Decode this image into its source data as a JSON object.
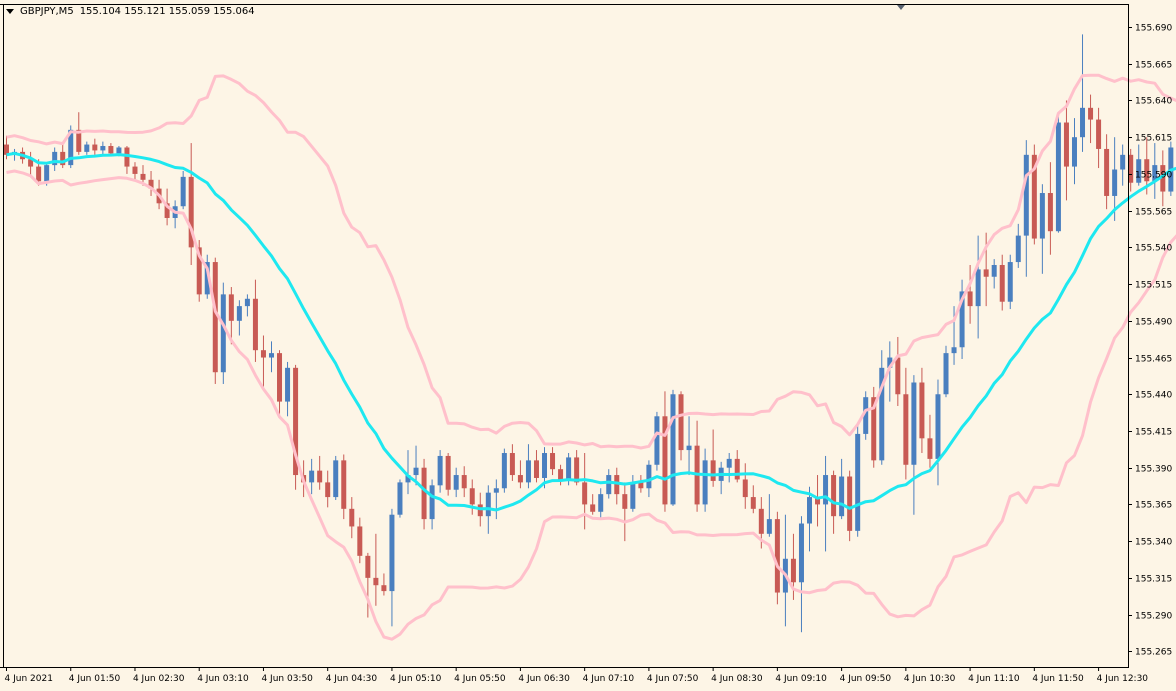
{
  "header": {
    "symbol": "GBPJPY,M5",
    "ohlc": "155.104 155.121 155.059 155.064"
  },
  "colors": {
    "background": "#fdf5e6",
    "bull_candle": "#4a7fbf",
    "bear_candle": "#c85a54",
    "middle_band": "#1ee8f0",
    "outer_bands": "#ffc0cb",
    "axis": "#000000"
  },
  "chart_data": {
    "type": "candlestick",
    "indicator": "bollinger bands",
    "grid": false,
    "ylim": [
      155.255,
      155.705
    ],
    "y_ticks": [
      "155.690",
      "155.665",
      "155.640",
      "155.615",
      "155.590",
      "155.565",
      "155.540",
      "155.515",
      "155.490",
      "155.465",
      "155.440",
      "155.415",
      "155.390",
      "155.365",
      "155.340",
      "155.315",
      "155.290",
      "155.265"
    ],
    "x_ticks": [
      "4 Jun 2021",
      "4 Jun 01:50",
      "4 Jun 02:30",
      "4 Jun 03:10",
      "4 Jun 03:50",
      "4 Jun 04:30",
      "4 Jun 05:10",
      "4 Jun 05:50",
      "4 Jun 06:30",
      "4 Jun 07:10",
      "4 Jun 07:50",
      "4 Jun 08:30",
      "4 Jun 09:10",
      "4 Jun 09:50",
      "4 Jun 10:30",
      "4 Jun 11:10",
      "4 Jun 11:50",
      "4 Jun 12:30"
    ],
    "candles": [
      [
        155.61,
        155.616,
        155.6,
        155.603
      ],
      [
        155.603,
        155.607,
        155.599,
        155.605
      ],
      [
        155.605,
        155.608,
        155.597,
        155.6
      ],
      [
        155.6,
        155.605,
        155.588,
        155.595
      ],
      [
        155.595,
        155.6,
        155.582,
        155.585
      ],
      [
        155.585,
        155.598,
        155.582,
        155.596
      ],
      [
        155.596,
        155.608,
        155.592,
        155.605
      ],
      [
        155.605,
        155.61,
        155.594,
        155.596
      ],
      [
        155.596,
        155.623,
        155.594,
        155.62
      ],
      [
        155.62,
        155.632,
        155.603,
        155.605
      ],
      [
        155.605,
        155.612,
        155.603,
        155.61
      ],
      [
        155.61,
        155.614,
        155.603,
        155.606
      ],
      [
        155.606,
        155.612,
        155.603,
        155.609
      ],
      [
        155.609,
        155.611,
        155.602,
        155.604
      ],
      [
        155.604,
        155.609,
        155.602,
        155.608
      ],
      [
        155.608,
        155.609,
        155.59,
        155.595
      ],
      [
        155.595,
        155.598,
        155.585,
        155.59
      ],
      [
        155.59,
        155.596,
        155.582,
        155.586
      ],
      [
        155.586,
        155.592,
        155.575,
        155.58
      ],
      [
        155.58,
        155.586,
        155.566,
        155.57
      ],
      [
        155.57,
        155.58,
        155.555,
        155.56
      ],
      [
        155.56,
        155.572,
        155.553,
        155.568
      ],
      [
        155.568,
        155.592,
        155.566,
        155.588
      ],
      [
        155.588,
        155.611,
        155.528,
        155.54
      ],
      [
        155.54,
        155.545,
        155.503,
        155.508
      ],
      [
        155.508,
        155.535,
        155.505,
        155.53
      ],
      [
        155.53,
        155.533,
        155.447,
        155.455
      ],
      [
        155.455,
        155.516,
        155.447,
        155.508
      ],
      [
        155.508,
        155.513,
        155.474,
        155.49
      ],
      [
        155.49,
        155.504,
        155.48,
        155.5
      ],
      [
        155.5,
        155.508,
        155.493,
        155.505
      ],
      [
        155.505,
        155.518,
        155.462,
        155.47
      ],
      [
        155.47,
        155.48,
        155.445,
        155.465
      ],
      [
        155.465,
        155.476,
        155.455,
        155.468
      ],
      [
        155.468,
        155.47,
        155.425,
        155.435
      ],
      [
        155.435,
        155.462,
        155.425,
        155.458
      ],
      [
        155.458,
        155.46,
        155.375,
        155.385
      ],
      [
        155.385,
        155.395,
        155.37,
        155.38
      ],
      [
        155.38,
        155.396,
        155.372,
        155.388
      ],
      [
        155.388,
        155.398,
        155.375,
        155.38
      ],
      [
        155.38,
        155.388,
        155.363,
        155.37
      ],
      [
        155.37,
        155.398,
        155.368,
        155.395
      ],
      [
        155.395,
        155.399,
        155.355,
        155.362
      ],
      [
        155.362,
        155.37,
        155.342,
        155.35
      ],
      [
        155.35,
        155.356,
        155.325,
        155.33
      ],
      [
        155.33,
        155.332,
        155.288,
        155.315
      ],
      [
        155.315,
        155.345,
        155.296,
        155.31
      ],
      [
        155.31,
        155.318,
        155.303,
        155.306
      ],
      [
        155.306,
        155.362,
        155.282,
        155.358
      ],
      [
        155.358,
        155.382,
        155.356,
        155.38
      ],
      [
        155.38,
        155.402,
        155.372,
        155.385
      ],
      [
        155.385,
        155.405,
        155.378,
        155.39
      ],
      [
        155.39,
        155.396,
        155.348,
        155.355
      ],
      [
        155.355,
        155.382,
        155.348,
        155.378
      ],
      [
        155.378,
        155.402,
        155.373,
        155.398
      ],
      [
        155.398,
        155.4,
        155.371,
        155.375
      ],
      [
        155.375,
        155.39,
        155.37,
        155.385
      ],
      [
        155.385,
        155.391,
        155.37,
        155.376
      ],
      [
        155.376,
        155.382,
        155.358,
        155.365
      ],
      [
        155.365,
        155.373,
        155.35,
        155.357
      ],
      [
        155.357,
        155.378,
        155.345,
        155.373
      ],
      [
        155.373,
        155.382,
        155.355,
        155.376
      ],
      [
        155.376,
        155.403,
        155.373,
        155.4
      ],
      [
        155.4,
        155.406,
        155.381,
        155.385
      ],
      [
        155.385,
        155.395,
        155.376,
        155.38
      ],
      [
        155.38,
        155.406,
        155.376,
        155.395
      ],
      [
        155.395,
        155.402,
        155.38,
        155.383
      ],
      [
        155.383,
        155.404,
        155.376,
        155.4
      ],
      [
        155.4,
        155.404,
        155.385,
        155.389
      ],
      [
        155.389,
        155.392,
        155.378,
        155.381
      ],
      [
        155.381,
        155.4,
        155.378,
        155.397
      ],
      [
        155.397,
        155.402,
        155.378,
        155.38
      ],
      [
        155.38,
        155.4,
        155.348,
        155.365
      ],
      [
        155.365,
        155.372,
        155.358,
        155.36
      ],
      [
        155.36,
        155.376,
        155.355,
        155.372
      ],
      [
        155.372,
        155.389,
        155.369,
        155.385
      ],
      [
        155.385,
        155.39,
        155.365,
        155.372
      ],
      [
        155.372,
        155.38,
        155.34,
        155.362
      ],
      [
        155.362,
        155.385,
        155.36,
        155.38
      ],
      [
        155.38,
        155.385,
        155.373,
        155.376
      ],
      [
        155.376,
        155.395,
        155.37,
        155.392
      ],
      [
        155.392,
        155.428,
        155.388,
        155.425
      ],
      [
        155.425,
        155.442,
        155.36,
        155.365
      ],
      [
        155.365,
        155.443,
        155.364,
        155.44
      ],
      [
        155.44,
        155.442,
        155.395,
        155.402
      ],
      [
        155.402,
        155.425,
        155.385,
        155.405
      ],
      [
        155.405,
        155.422,
        155.36,
        155.365
      ],
      [
        155.365,
        155.403,
        155.36,
        155.395
      ],
      [
        155.395,
        155.416,
        155.377,
        155.381
      ],
      [
        155.381,
        155.394,
        155.372,
        155.39
      ],
      [
        155.39,
        155.4,
        155.38,
        155.396
      ],
      [
        155.396,
        155.402,
        155.38,
        155.382
      ],
      [
        155.382,
        155.393,
        155.362,
        155.37
      ],
      [
        155.37,
        155.378,
        155.359,
        155.362
      ],
      [
        155.362,
        155.37,
        155.335,
        155.345
      ],
      [
        155.345,
        155.372,
        155.343,
        155.355
      ],
      [
        155.355,
        155.36,
        155.297,
        155.305
      ],
      [
        155.305,
        155.358,
        155.282,
        155.328
      ],
      [
        155.328,
        155.345,
        155.3,
        155.312
      ],
      [
        155.312,
        155.357,
        155.278,
        155.352
      ],
      [
        155.352,
        155.377,
        155.333,
        155.37
      ],
      [
        155.37,
        155.385,
        155.35,
        155.365
      ],
      [
        155.365,
        155.398,
        155.333,
        155.385
      ],
      [
        155.385,
        155.388,
        155.345,
        155.357
      ],
      [
        155.357,
        155.396,
        155.355,
        155.384
      ],
      [
        155.384,
        155.388,
        155.34,
        155.347
      ],
      [
        155.347,
        155.42,
        155.343,
        155.413
      ],
      [
        155.413,
        155.442,
        155.409,
        155.438
      ],
      [
        155.438,
        155.445,
        155.39,
        155.395
      ],
      [
        155.395,
        155.47,
        155.392,
        155.458
      ],
      [
        155.458,
        155.476,
        155.435,
        155.465
      ],
      [
        155.465,
        155.479,
        155.432,
        155.44
      ],
      [
        155.44,
        155.458,
        155.382,
        155.392
      ],
      [
        155.392,
        155.453,
        155.358,
        155.448
      ],
      [
        155.448,
        155.458,
        155.4,
        155.41
      ],
      [
        155.41,
        155.426,
        155.39,
        155.396
      ],
      [
        155.396,
        155.45,
        155.378,
        155.44
      ],
      [
        155.44,
        155.473,
        155.438,
        155.468
      ],
      [
        155.468,
        155.5,
        155.46,
        155.472
      ],
      [
        155.472,
        155.518,
        155.464,
        155.51
      ],
      [
        155.51,
        155.528,
        155.488,
        155.5
      ],
      [
        155.5,
        155.548,
        155.478,
        155.525
      ],
      [
        155.525,
        155.55,
        155.5,
        155.52
      ],
      [
        155.52,
        155.532,
        155.512,
        155.528
      ],
      [
        155.528,
        155.535,
        155.497,
        155.503
      ],
      [
        155.503,
        155.535,
        155.498,
        155.53
      ],
      [
        155.53,
        155.556,
        155.526,
        155.548
      ],
      [
        155.548,
        155.613,
        155.52,
        155.603
      ],
      [
        155.603,
        155.61,
        155.542,
        155.546
      ],
      [
        155.546,
        155.583,
        155.522,
        155.577
      ],
      [
        155.577,
        155.598,
        155.535,
        155.551
      ],
      [
        155.551,
        155.632,
        155.55,
        155.625
      ],
      [
        155.625,
        155.64,
        155.572,
        155.595
      ],
      [
        155.595,
        155.628,
        155.583,
        155.615
      ],
      [
        155.615,
        155.685,
        155.605,
        155.635
      ],
      [
        155.635,
        155.644,
        155.611,
        155.627
      ],
      [
        155.627,
        155.635,
        155.594,
        155.607
      ],
      [
        155.607,
        155.617,
        155.566,
        155.575
      ],
      [
        155.575,
        155.615,
        155.558,
        155.593
      ],
      [
        155.593,
        155.61,
        155.582,
        155.603
      ],
      [
        155.603,
        155.607,
        155.578,
        155.584
      ],
      [
        155.584,
        155.61,
        155.582,
        155.6
      ],
      [
        155.6,
        155.615,
        155.576,
        155.585
      ],
      [
        155.585,
        155.611,
        155.573,
        155.596
      ],
      [
        155.596,
        155.606,
        155.568,
        155.578
      ],
      [
        155.578,
        155.612,
        155.575,
        155.608
      ],
      [
        155.608,
        155.615,
        155.562,
        155.585
      ],
      [
        155.585,
        155.605,
        155.558,
        155.575
      ],
      [
        155.575,
        155.59,
        155.56,
        155.565
      ]
    ]
  }
}
